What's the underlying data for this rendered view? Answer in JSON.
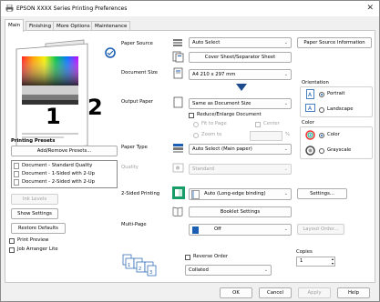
{
  "window": {
    "title": "EPSON XXXX Series Printing Preferences",
    "close_glyph": "✕"
  },
  "tabs": [
    "Main",
    "Finishing",
    "More Options",
    "Maintenance"
  ],
  "preview": {
    "page1": "1",
    "page2": "2"
  },
  "paper_source": {
    "label": "Paper Source",
    "value": "Auto Select",
    "info_button": "Paper Source Information",
    "separator_button": "Cover Sheet/Separator Sheet"
  },
  "document_size": {
    "label": "Document Size",
    "value": "A4 210 x 297 mm"
  },
  "output_paper": {
    "label": "Output Paper",
    "value": "Same as Document Size",
    "reduce_enlarge": "Reduce/Enlarge Document",
    "fit_to_page": "Fit to Page",
    "center": "Center",
    "zoom_to": "Zoom to",
    "zoom_unit": "%"
  },
  "orientation": {
    "label": "Orientation",
    "portrait": "Portrait",
    "landscape": "Landscape"
  },
  "color": {
    "label": "Color",
    "color": "Color",
    "grayscale": "Grayscale"
  },
  "paper_type": {
    "label": "Paper Type",
    "value": "Auto Select (Main paper)"
  },
  "quality": {
    "label": "Quality",
    "value": "Standard"
  },
  "presets": {
    "label": "Printing Presets",
    "add_remove": "Add/Remove Presets...",
    "items": [
      "Document - Standard Quality",
      "Document - 1-Sided with 2-Up",
      "Document - 2-Sided with 2-Up"
    ]
  },
  "two_sided": {
    "label": "2-Sided Printing",
    "value": "Auto (Long-edge binding)",
    "settings": "Settings...",
    "booklet": "Booklet Settings"
  },
  "multi_page": {
    "label": "Multi-Page",
    "value": "Off",
    "layout_order": "Layout Order..."
  },
  "left_buttons": {
    "ink_levels": "Ink Levels",
    "show_settings": "Show Settings",
    "restore_defaults": "Restore Defaults"
  },
  "left_checks": {
    "print_preview": "Print Preview",
    "job_arranger": "Job Arranger Lite"
  },
  "copies": {
    "label": "Copies",
    "value": "1",
    "reverse_order": "Reverse Order",
    "collate": "Collated"
  },
  "footer": {
    "ok": "OK",
    "cancel": "Cancel",
    "apply": "Apply",
    "help": "Help"
  },
  "colors": {
    "accent": "#1a5fb4",
    "border": "#adadad",
    "disabled": "#a0a0a0"
  }
}
